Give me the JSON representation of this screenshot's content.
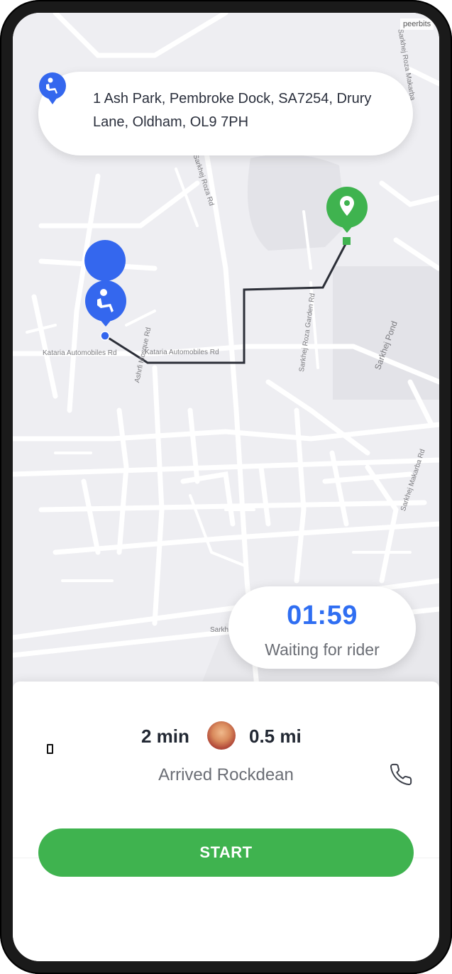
{
  "map": {
    "attribution": "peerbits",
    "road_labels": {
      "kataria_1": "Kataria Automobiles Rd",
      "kataria_2": "Kataria Automobiles Rd",
      "ashrfi": "Ashrfi Mosque Rd",
      "sarkhej_roza": "Sarkhej Roza Rd",
      "roza_garden": "Sarkhej Roza Garden Rd",
      "sarkhej_pond": "Sarkhej Pond",
      "makarba": "Sarkhej Makarba Rd",
      "makarba_top": "Sarkhej Roza Makarba",
      "sarkhe": "Sarkhe"
    },
    "route_color": "#2c2f38",
    "pickup_color": "#3467ee",
    "dropoff_color": "#3fb34f"
  },
  "pickup": {
    "address": "1 Ash Park, Pembroke Dock, SA7254, Drury Lane, Oldham, OL9 7PH"
  },
  "timer": {
    "value": "01:59",
    "caption": "Waiting for rider"
  },
  "trip": {
    "time": "2 min",
    "distance": "0.5 mi",
    "status": "Arrived Rockdean"
  },
  "actions": {
    "start_label": "START"
  }
}
